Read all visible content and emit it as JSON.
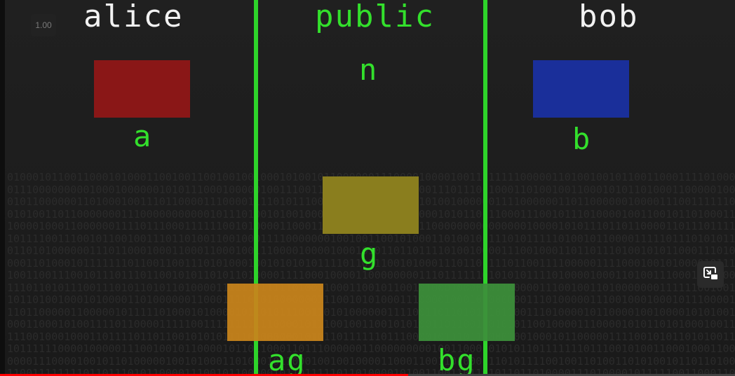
{
  "columns": {
    "left_title": "alice",
    "center_title": "public",
    "right_title": "bob"
  },
  "labels": {
    "n": "n",
    "a": "a",
    "b": "b",
    "g": "g",
    "ag": "ag",
    "bg": "bg"
  },
  "player": {
    "playback_speed": "1.00",
    "progress": 0.555
  },
  "colors": {
    "divider": "#2ed42a",
    "label_green": "#33e02c",
    "box_a_red": "#8a1717",
    "box_b_blue": "#1a2f9a",
    "box_g_olive": "#8a7e1e",
    "box_ag_orange": "#c8841c",
    "box_bg_green": "#3d8f3a",
    "progress_red": "#ff0000"
  },
  "icons": {
    "pip": "picture-in-picture-icon"
  }
}
